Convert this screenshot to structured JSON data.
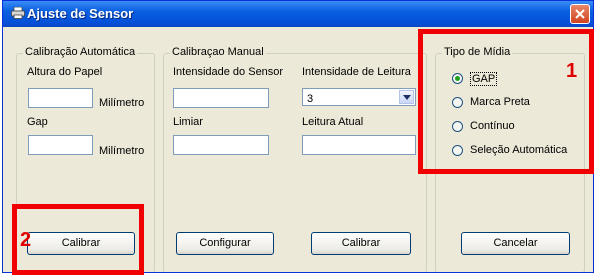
{
  "window": {
    "title": "Ajuste de Sensor"
  },
  "auto_group": {
    "legend": "Calibração Automática",
    "paper_height_label": "Altura do Papel",
    "paper_height_value": "",
    "paper_height_unit": "Milímetro",
    "gap_label": "Gap",
    "gap_value": "",
    "gap_unit": "Milímetro",
    "calibrate_label": "Calibrar"
  },
  "manual_group": {
    "legend": "Calibraçao Manual",
    "sensor_intensity_label": "Intensidade do Sensor",
    "sensor_intensity_value": "",
    "read_intensity_label": "Intensidade de Leitura",
    "read_intensity_value": "3",
    "threshold_label": "Limiar",
    "threshold_value": "",
    "current_read_label": "Leitura Atual",
    "current_read_value": "",
    "configure_label": "Configurar",
    "calibrate_label": "Calibrar"
  },
  "media_group": {
    "legend": "Tipo de Mídia",
    "options": [
      {
        "label": "GAP",
        "selected": true
      },
      {
        "label": "Marca Preta",
        "selected": false
      },
      {
        "label": "Contínuo",
        "selected": false
      },
      {
        "label": "Seleção Automática",
        "selected": false
      }
    ],
    "cancel_label": "Cancelar"
  },
  "annotations": [
    {
      "number": "1",
      "color": "#f00000"
    },
    {
      "number": "2",
      "color": "#f00000"
    }
  ]
}
